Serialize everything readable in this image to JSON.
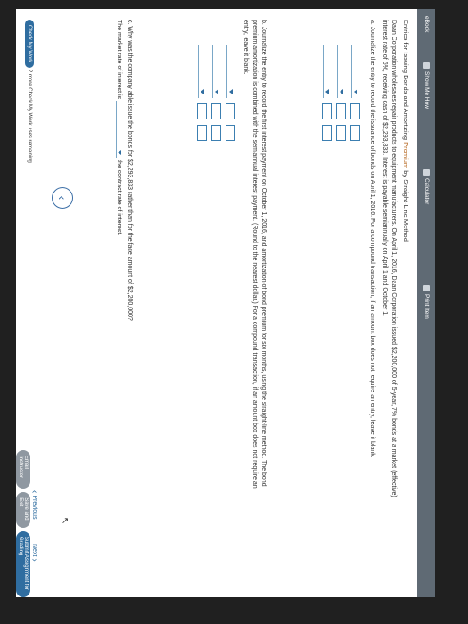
{
  "toolbar": {
    "ebook": "eBook",
    "show_me_how": "Show Me How",
    "calculator": "Calculator",
    "print_item": "Print Item"
  },
  "problem": {
    "title_start": "Entries for Issuing Bonds and Amortizing ",
    "title_highlight": "Premium",
    "title_end": " by Straight-Line Method",
    "description_line1": "Daan Corporation wholesales repair products to equipment manufacturers. On April 1, 2016, Daan Corporation issued $2,200,000 of 5-year, 7% bonds at a market (effective)",
    "description_line2": "interest rate of 6%, receiving cash of $2,293,833. Interest is payable semiannually on April 1 and October 1."
  },
  "part_a": {
    "instruction": "a. Journalize the entry to record the issuance of bonds on April 1, 2016. For a compound transaction, if an amount box does not require an entry, leave it blank."
  },
  "part_b": {
    "instruction_line1": "b. Journalize the entry to record the first interest payment on October 1, 2016, and amortization of bond premium for six months, using the straight-line method. The bond",
    "instruction_line2": "premium amortization is combined with the semiannual interest payment. (Round to the nearest dollar.) For a compound transaction, if an amount box does not require an",
    "instruction_line3": "entry, leave it blank."
  },
  "part_c": {
    "question": "c. Why was the company able issue the bonds for $2,293,833 rather than for the face amount of $2,200,000?",
    "sentence_start": "The market rate of interest is",
    "sentence_end": "the contract rate of interest."
  },
  "footer": {
    "check_my_work": "Check My Work",
    "remaining": "2 more Check My Work uses remaining.",
    "previous": "Previous",
    "next": "Next",
    "email_instructor": "Email Instructor",
    "save_and_exit": "Save and Exit",
    "submit": "Submit Assignment for Grading"
  }
}
